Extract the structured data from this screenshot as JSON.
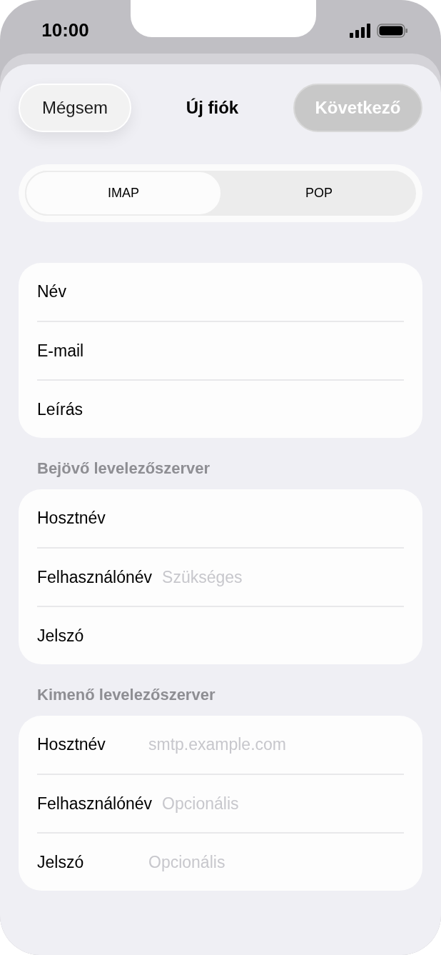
{
  "status_bar": {
    "time": "10:00"
  },
  "nav": {
    "cancel": "Mégsem",
    "title": "Új fiók",
    "next": {
      "label": "Következő",
      "disabled": true
    }
  },
  "segments": [
    {
      "label": "IMAP",
      "selected": true
    },
    {
      "label": "POP",
      "selected": false
    }
  ],
  "sections": [
    {
      "rows": [
        {
          "label": "Név"
        },
        {
          "label": "E-mail"
        },
        {
          "label": "Leírás"
        }
      ]
    },
    {
      "header": "Bejövő levelezőszerver",
      "rows": [
        {
          "label": "Hosztnév"
        },
        {
          "label": "Felhasználónév",
          "placeholder": "Szükséges"
        },
        {
          "label": "Jelszó"
        }
      ]
    },
    {
      "header": "Kimenő levelezőszerver",
      "rows": [
        {
          "label": "Hosztnév",
          "placeholder": "smtp.example.com"
        },
        {
          "label": "Felhasználónév",
          "placeholder": "Opcionális"
        },
        {
          "label": "Jelszó",
          "placeholder": "Opcionális"
        }
      ]
    }
  ]
}
